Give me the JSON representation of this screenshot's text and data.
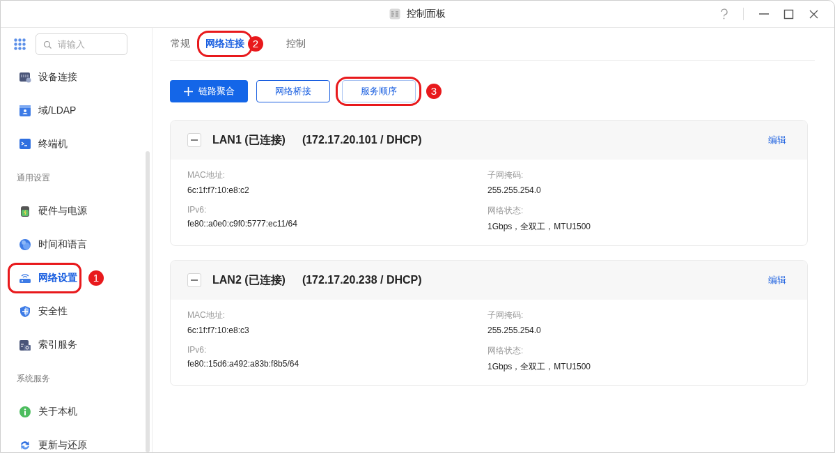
{
  "window": {
    "title": "控制面板"
  },
  "sidebar": {
    "search": {
      "placeholder": "请输入"
    },
    "items": [
      {
        "kind": "item",
        "label": "设备连接",
        "selected": false
      },
      {
        "kind": "item",
        "label": "域/LDAP",
        "selected": false
      },
      {
        "kind": "item",
        "label": "终端机",
        "selected": false
      },
      {
        "kind": "header",
        "label": "通用设置"
      },
      {
        "kind": "item",
        "label": "硬件与电源",
        "selected": false
      },
      {
        "kind": "item",
        "label": "时间和语言",
        "selected": false
      },
      {
        "kind": "item",
        "label": "网络设置",
        "selected": true,
        "callout": "1"
      },
      {
        "kind": "item",
        "label": "安全性",
        "selected": false
      },
      {
        "kind": "item",
        "label": "索引服务",
        "selected": false
      },
      {
        "kind": "header",
        "label": "系统服务"
      },
      {
        "kind": "item",
        "label": "关于本机",
        "selected": false
      },
      {
        "kind": "item",
        "label": "更新与还原",
        "selected": false
      }
    ]
  },
  "tabs": [
    {
      "label": "常规",
      "selected": false
    },
    {
      "label": "网络连接",
      "selected": true,
      "callout": "2"
    },
    {
      "label": "控制",
      "selected": false
    }
  ],
  "toolbar": [
    {
      "kind": "primary",
      "label": "链路聚合"
    },
    {
      "kind": "outline",
      "label": "网络桥接"
    },
    {
      "kind": "plain",
      "label": "服务顺序",
      "callout": "3"
    }
  ],
  "interfaces": [
    {
      "name": "LAN1 (已连接)",
      "address": "(172.17.20.101 / DHCP)",
      "expanded": true,
      "action": "编辑",
      "fields": [
        {
          "label": "MAC地址:",
          "value": "6c:1f:f7:10:e8:c2"
        },
        {
          "label": "子网掩码:",
          "value": "255.255.254.0"
        },
        {
          "label": "IPv6:",
          "value": "fe80::a0e0:c9f0:5777:ec11/64"
        },
        {
          "label": "网络状态:",
          "value": "1Gbps，全双工，MTU1500"
        }
      ]
    },
    {
      "name": "LAN2 (已连接)",
      "address": "(172.17.20.238 / DHCP)",
      "expanded": true,
      "action": "编辑",
      "fields": [
        {
          "label": "MAC地址:",
          "value": "6c:1f:f7:10:e8:c3"
        },
        {
          "label": "子网掩码:",
          "value": "255.255.254.0"
        },
        {
          "label": "IPv6:",
          "value": "fe80::15d6:a492:a83b:f8b5/64"
        },
        {
          "label": "网络状态:",
          "value": "1Gbps，全双工，MTU1500"
        }
      ]
    }
  ]
}
